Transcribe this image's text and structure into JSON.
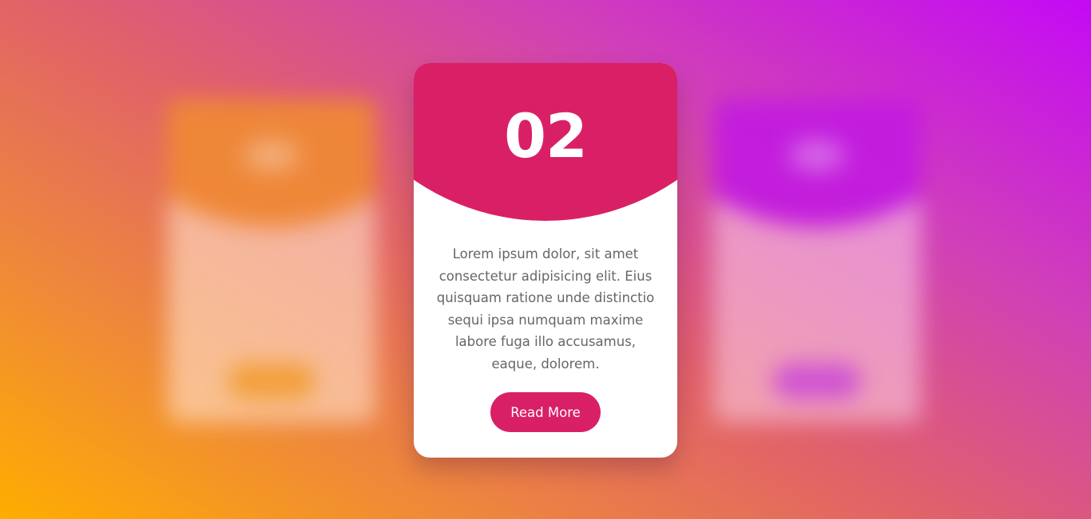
{
  "colors": {
    "card_accent": "#d92066",
    "left_card_accent": "#f08a35",
    "right_card_accent": "#c21be0",
    "text_gray": "#666666"
  },
  "cards": {
    "left": {
      "state": "blurred"
    },
    "center": {
      "number": "02",
      "description": "Lorem ipsum dolor, sit amet consectetur adipisicing elit. Eius quisquam ratione unde distinctio sequi ipsa numquam maxime labore fuga illo accusamus, eaque, dolorem.",
      "button_label": "Read More"
    },
    "right": {
      "state": "blurred"
    }
  }
}
